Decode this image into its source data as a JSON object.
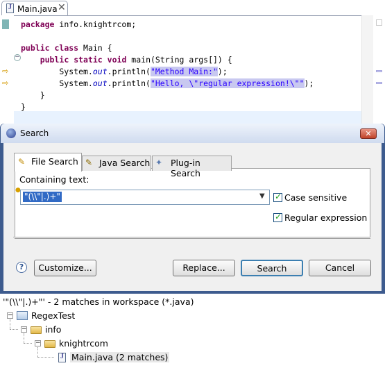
{
  "editor": {
    "tab_title": "Main.java",
    "close_glyph": "✕",
    "lines": [
      {
        "parts": [
          {
            "t": "package",
            "c": "kw"
          },
          {
            "t": " info.knightrcom;",
            "c": ""
          }
        ]
      },
      {
        "parts": []
      },
      {
        "parts": [
          {
            "t": "public",
            "c": "kw"
          },
          {
            "t": " ",
            "c": ""
          },
          {
            "t": "class",
            "c": "kw"
          },
          {
            "t": " Main {",
            "c": ""
          }
        ]
      },
      {
        "parts": [
          {
            "t": "    ",
            "c": ""
          },
          {
            "t": "public",
            "c": "kw"
          },
          {
            "t": " ",
            "c": ""
          },
          {
            "t": "static",
            "c": "kw"
          },
          {
            "t": " ",
            "c": ""
          },
          {
            "t": "void",
            "c": "kw"
          },
          {
            "t": " main(String args[]) {",
            "c": ""
          }
        ]
      },
      {
        "parts": [
          {
            "t": "        System.",
            "c": ""
          },
          {
            "t": "out",
            "c": "fld"
          },
          {
            "t": ".println(",
            "c": ""
          },
          {
            "t": "\"Method Main:\"",
            "c": "str"
          },
          {
            "t": ");",
            "c": ""
          }
        ]
      },
      {
        "parts": [
          {
            "t": "        System.",
            "c": ""
          },
          {
            "t": "out",
            "c": "fld"
          },
          {
            "t": ".println(",
            "c": ""
          },
          {
            "t": "\"Hello, \\\"regular expression!\\\"\"",
            "c": "str"
          },
          {
            "t": ");",
            "c": ""
          }
        ]
      },
      {
        "parts": [
          {
            "t": "    }",
            "c": ""
          }
        ]
      },
      {
        "parts": [
          {
            "t": "}",
            "c": ""
          }
        ]
      }
    ]
  },
  "dialog": {
    "title": "Search",
    "close_glyph": "✕",
    "tabs": [
      {
        "label": "File Search",
        "active": true,
        "icon": "file-search-icon"
      },
      {
        "label": "Java Search",
        "active": false,
        "icon": "java-search-icon"
      },
      {
        "label": "Plug-in Search",
        "active": false,
        "icon": "plugin-search-icon"
      }
    ],
    "containing_label": "Containing text:",
    "pattern_value": "\"(\\\\\"|.)+\"",
    "case_sensitive": {
      "label": "Case sensitive",
      "checked": true
    },
    "regular_expression": {
      "label": "Regular expression",
      "checked": true
    },
    "buttons": {
      "help": "?",
      "customize": "Customize...",
      "replace": "Replace...",
      "search": "Search",
      "cancel": "Cancel"
    }
  },
  "results": {
    "header": "'\"(\\\\\"|.)+\"' - 2 matches in workspace (*.java)",
    "tree": [
      {
        "label": "RegexTest",
        "type": "project"
      },
      {
        "label": "info",
        "type": "folder"
      },
      {
        "label": "knightrcom",
        "type": "folder"
      },
      {
        "label": "Main.java (2 matches)",
        "type": "file"
      }
    ]
  }
}
